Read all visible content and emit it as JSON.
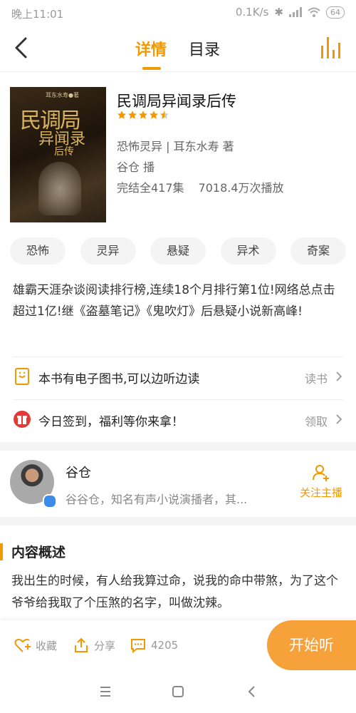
{
  "status": {
    "time": "晚上11:01",
    "speed": "0.1K/s",
    "battery": "64"
  },
  "nav": {
    "tab_detail": "详情",
    "tab_toc": "目录"
  },
  "book": {
    "cover_author": "耳东水寿●著",
    "cover_title_1": "民调局",
    "cover_title_2": "异闻录",
    "cover_title_3": "后传",
    "title": "民调局异闻录后传",
    "rating": 4.5,
    "category": "恐怖灵异",
    "author_line": "耳东水寿  著",
    "narrator_line": "谷仓  播",
    "status": "完结全417集",
    "plays": "7018.4万次播放"
  },
  "tags": [
    "恐怖",
    "灵异",
    "悬疑",
    "异术",
    "奇案"
  ],
  "intro": "雄霸天涯杂谈阅读排行榜,连续18个月排行第1位!网络总点击超过1亿!继《盗墓笔记》《鬼吹灯》后悬疑小说新高峰!",
  "rows": [
    {
      "label": "本书有电子图书,可以边听边读",
      "action": "读书"
    },
    {
      "label": "今日签到，福利等你来拿！",
      "action": "领取"
    }
  ],
  "anchor": {
    "name": "谷仓",
    "desc": "谷谷仓，知名有声小说演播者，其...",
    "follow": "关注主播"
  },
  "summary": {
    "title": "内容概述",
    "text": "我出生的时候，有人给我算过命，说我的命中带煞，为了这个爷爷给我取了个压煞的名字，叫做沈辣。"
  },
  "bottom": {
    "collect": "收藏",
    "share": "分享",
    "comments": "4205",
    "listen": "开始听"
  },
  "colors": {
    "accent": "#f39800",
    "listen_button": "#f6a13a",
    "gift": "#e53935"
  }
}
